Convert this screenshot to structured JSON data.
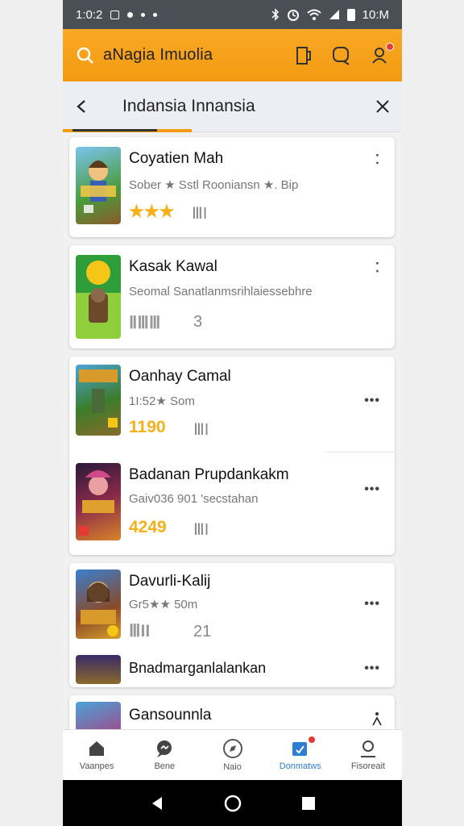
{
  "status_bar": {
    "time": "1:0:2",
    "right_time": "10:M"
  },
  "app_bar": {
    "title": "aNagia Imuolia",
    "icons": [
      "search-icon",
      "bookmark-icon",
      "chat-icon",
      "notification-icon"
    ]
  },
  "sub_bar": {
    "title": "Indansia Innansia",
    "back_icon": "back-arrow-icon",
    "close_icon": "close-icon"
  },
  "items": [
    {
      "name": "Coyatien Mah",
      "meta": "Sober ★ Sstl Rooniansn ★. Bip",
      "rating": "★★★",
      "count": "ⅢI"
    },
    {
      "name": "Kasak Kawal",
      "meta": "Seomal Sanatlanmsrihlaiessebhre",
      "rating": "ⅡⅢⅢ",
      "count": "3"
    },
    {
      "name": "Oanhay Camal",
      "meta": "1I:52★ Som",
      "rating": "1190",
      "count": "ⅢI"
    },
    {
      "name": "Badanan Prupdankakm",
      "meta": "Gaiv036 901 'secstahan",
      "rating": "4249",
      "count": "ⅢI"
    },
    {
      "name": "Davurli-Kalij",
      "meta": "Gr5★★ 50m",
      "rating": "ⅢII",
      "count": "21"
    },
    {
      "name": "Bnadmarganlalankan"
    },
    {
      "name": "Gansounnla"
    }
  ],
  "bottom_nav": [
    {
      "label": "Vaanpes",
      "icon": "home-icon"
    },
    {
      "label": "Bene",
      "icon": "chat-bubble-icon"
    },
    {
      "label": "Naio",
      "icon": "compass-icon"
    },
    {
      "label": "Donmatws",
      "icon": "downloads-icon"
    },
    {
      "label": "Fisoreait",
      "icon": "profile-icon"
    }
  ],
  "colors": {
    "accent": "#f39b12",
    "active_nav": "#2d7fd3",
    "rating": "#f5b01a"
  }
}
